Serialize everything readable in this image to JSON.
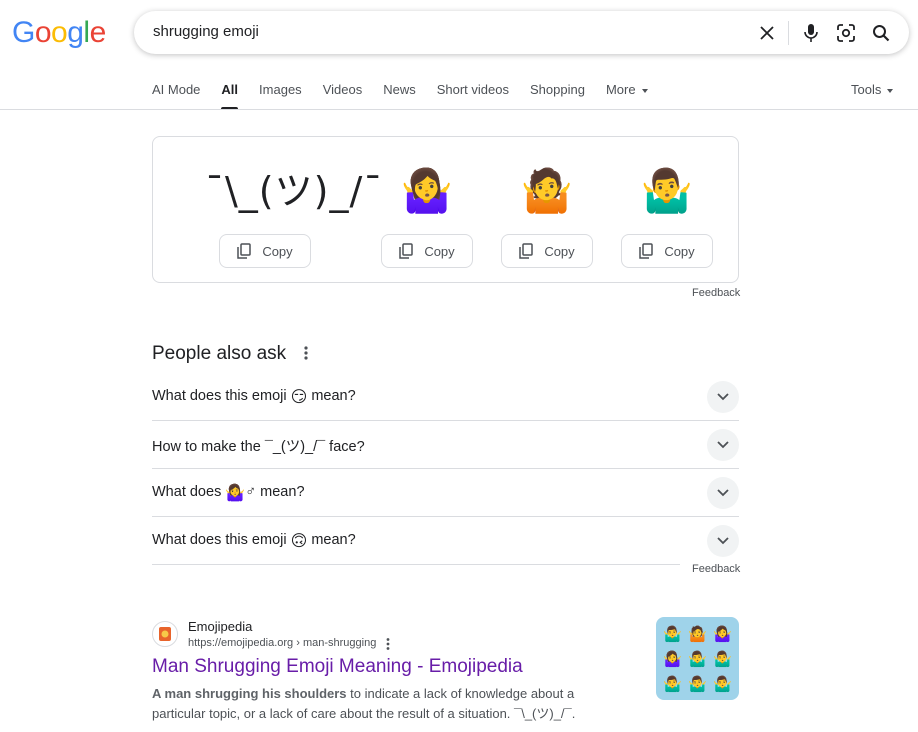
{
  "logo": {
    "letters": [
      "G",
      "o",
      "o",
      "g",
      "l",
      "e"
    ],
    "colors": [
      "#4285F4",
      "#EA4335",
      "#FBBC05",
      "#4285F4",
      "#34A853",
      "#EA4335"
    ]
  },
  "search": {
    "query": "shrugging emoji"
  },
  "tabs": [
    {
      "label": "AI Mode"
    },
    {
      "label": "All"
    },
    {
      "label": "Images"
    },
    {
      "label": "Videos"
    },
    {
      "label": "News"
    },
    {
      "label": "Short videos"
    },
    {
      "label": "Shopping"
    },
    {
      "label": "More"
    }
  ],
  "tools_label": "Tools",
  "emoji_card": {
    "items": [
      {
        "glyph": "¯\\_(ツ)_/¯",
        "copy_label": "Copy"
      },
      {
        "glyph": "🤷‍♀️",
        "copy_label": "Copy"
      },
      {
        "glyph": "🤷",
        "copy_label": "Copy"
      },
      {
        "glyph": "🤷‍♂️",
        "copy_label": "Copy"
      }
    ],
    "feedback": "Feedback"
  },
  "people_also_ask": {
    "title": "People also ask",
    "questions": [
      {
        "before": "What does this emoji ",
        "emoji": "😏",
        "after": " mean?"
      },
      {
        "before": "How to make the ¯_(ツ)_/¯ face?",
        "emoji": "",
        "after": ""
      },
      {
        "before": "What does ",
        "emoji": "🤷‍♀️",
        "after": "♂ mean?"
      },
      {
        "before": "What does this emoji ",
        "emoji": "🙃",
        "after": " mean?"
      }
    ],
    "feedback": "Feedback"
  },
  "result": {
    "site_name": "Emojipedia",
    "url": "https://emojipedia.org › man-shrugging",
    "title": "Man Shrugging Emoji Meaning - Emojipedia",
    "snippet_bold": "A man shrugging his shoulders",
    "snippet_rest": " to indicate a lack of knowledge about a particular topic, or a lack of care about the result of a situation. ¯\\_(ツ)_/¯.",
    "thumbnail_emojis": [
      "🤷‍♂️",
      "🤷",
      "🤷‍♀️",
      "🤷‍♀️",
      "🤷‍♂️",
      "🤷‍♂️",
      "🤷‍♂️",
      "🤷‍♂️",
      "🤷‍♂️"
    ]
  }
}
